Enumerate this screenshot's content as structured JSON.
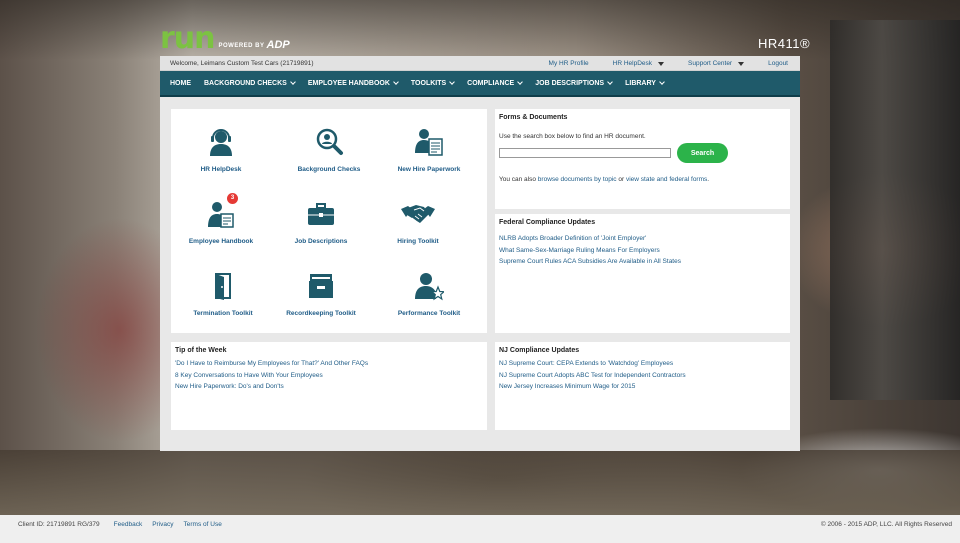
{
  "brand": {
    "logo_run": "ru",
    "logo_run_end": "n",
    "powered_by": "POWERED BY",
    "adp": "ADP",
    "product": "HR411®"
  },
  "topbar": {
    "welcome": "Welcome, Leimans Custom Test Cars (21719891)",
    "links": [
      "My HR Profile",
      "HR HelpDesk",
      "Support Center",
      "Logout"
    ]
  },
  "nav": {
    "items": [
      "HOME",
      "BACKGROUND CHECKS",
      "EMPLOYEE HANDBOOK",
      "TOOLKITS",
      "COMPLIANCE",
      "JOB DESCRIPTIONS",
      "LIBRARY"
    ]
  },
  "tiles": [
    {
      "label": "HR HelpDesk",
      "icon": "headset-user-icon"
    },
    {
      "label": "Background Checks",
      "icon": "magnifier-user-icon"
    },
    {
      "label": "New Hire Paperwork",
      "icon": "user-document-icon"
    },
    {
      "label": "Employee Handbook",
      "icon": "user-clipboard-icon",
      "badge": "3"
    },
    {
      "label": "Job Descriptions",
      "icon": "briefcase-icon"
    },
    {
      "label": "Hiring Toolkit",
      "icon": "handshake-icon"
    },
    {
      "label": "Termination Toolkit",
      "icon": "door-exit-icon"
    },
    {
      "label": "Recordkeeping Toolkit",
      "icon": "file-box-icon"
    },
    {
      "label": "Performance Toolkit",
      "icon": "user-star-icon"
    }
  ],
  "forms": {
    "title": "Forms & Documents",
    "instruction": "Use the search box below to find an HR document.",
    "search_placeholder": "",
    "search_button": "Search",
    "also_prefix": "You can also ",
    "browse_link": "browse documents by topic",
    "or": " or ",
    "state_link": "view state and federal forms",
    "end": "."
  },
  "federal": {
    "title": "Federal Compliance Updates",
    "items": [
      "NLRB Adopts Broader Definition of 'Joint Employer'",
      "What Same-Sex-Marriage Ruling Means For Employers",
      "Supreme Court Rules ACA Subsidies Are Available in All States"
    ]
  },
  "tip": {
    "title": "Tip of the Week",
    "items": [
      "'Do I Have to Reimburse My Employees for That?' And Other FAQs",
      "8 Key Conversations to Have With Your Employees",
      "New Hire Paperwork: Do's and Don'ts"
    ]
  },
  "nj": {
    "title": "NJ Compliance Updates",
    "items": [
      "NJ Supreme Court: CEPA Extends to 'Watchdog' Employees",
      "NJ Supreme Court Adopts ABC Test for Independent Contractors",
      "New Jersey Increases Minimum Wage for 2015"
    ]
  },
  "footer": {
    "client_id": "Client ID: 21719891 RG/379",
    "links": [
      "Feedback",
      "Privacy",
      "Terms of Use"
    ],
    "copyright": "© 2006 - 2015 ADP, LLC. All Rights Reserved"
  },
  "colors": {
    "nav_bg": "#1f5a6a",
    "link": "#1f5c87",
    "icon": "#1f5a6a",
    "search_button": "#2cb34a",
    "badge": "#e53935"
  }
}
